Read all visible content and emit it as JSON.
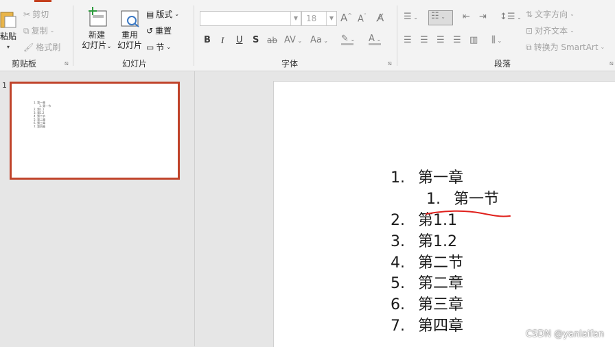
{
  "ribbon": {
    "clipboard": {
      "paste_label": "粘贴",
      "cut_label": "剪切",
      "copy_label": "复制",
      "format_painter_label": "格式刷",
      "group_label": "剪贴板"
    },
    "slides": {
      "new_slide_label": [
        "新建",
        "幻灯片"
      ],
      "reuse_slide_label": [
        "重用",
        "幻灯片"
      ],
      "layout_label": "版式",
      "reset_label": "重置",
      "section_label": "节",
      "group_label": "幻灯片"
    },
    "font": {
      "font_name_value": "",
      "font_size_value": "18",
      "group_label": "字体",
      "bold": "B",
      "italic": "I",
      "underline": "U",
      "shadow": "S",
      "strikethrough": "ab",
      "spacing": "AV",
      "change_case": "Aa",
      "grow": "A",
      "shrink": "A"
    },
    "paragraph": {
      "text_direction_label": "文字方向",
      "align_text_label": "对齐文本",
      "smartart_label": "转换为 SmartArt",
      "group_label": "段落"
    }
  },
  "thumbnail": {
    "slide_number": "1",
    "lines": [
      "1.  第一章",
      "1.  第一节",
      "2.  第1.1",
      "3.  第1.2",
      "4.  第二节",
      "5.  第二章",
      "6.  第三章",
      "7.  第四章"
    ]
  },
  "slide": {
    "items": [
      {
        "num": "1.",
        "text": "第一章"
      },
      {
        "num": "1.",
        "text": "第一节"
      },
      {
        "num": "2.",
        "text": "第1.1"
      },
      {
        "num": "3.",
        "text": "第1.2"
      },
      {
        "num": "4.",
        "text": "第二节"
      },
      {
        "num": "5.",
        "text": "第二章"
      },
      {
        "num": "6.",
        "text": "第三章"
      },
      {
        "num": "7.",
        "text": "第四章"
      }
    ]
  },
  "watermark": "CSDN @yanlaifan",
  "colors": {
    "accent": "#c43e1c",
    "thumbnail_border": "#c0432a",
    "annotation_underline": "#e0201c"
  },
  "icons": [
    "paste-icon",
    "cut-icon",
    "copy-icon",
    "format-painter-icon",
    "new-slide-icon",
    "reuse-slide-icon",
    "layout-icon",
    "reset-icon",
    "section-icon",
    "bullets-icon",
    "numbering-icon",
    "decrease-indent-icon",
    "increase-indent-icon",
    "line-spacing-icon",
    "text-direction-icon",
    "align-text-icon",
    "smartart-icon",
    "highlight-icon",
    "font-color-icon",
    "clear-format-icon"
  ]
}
